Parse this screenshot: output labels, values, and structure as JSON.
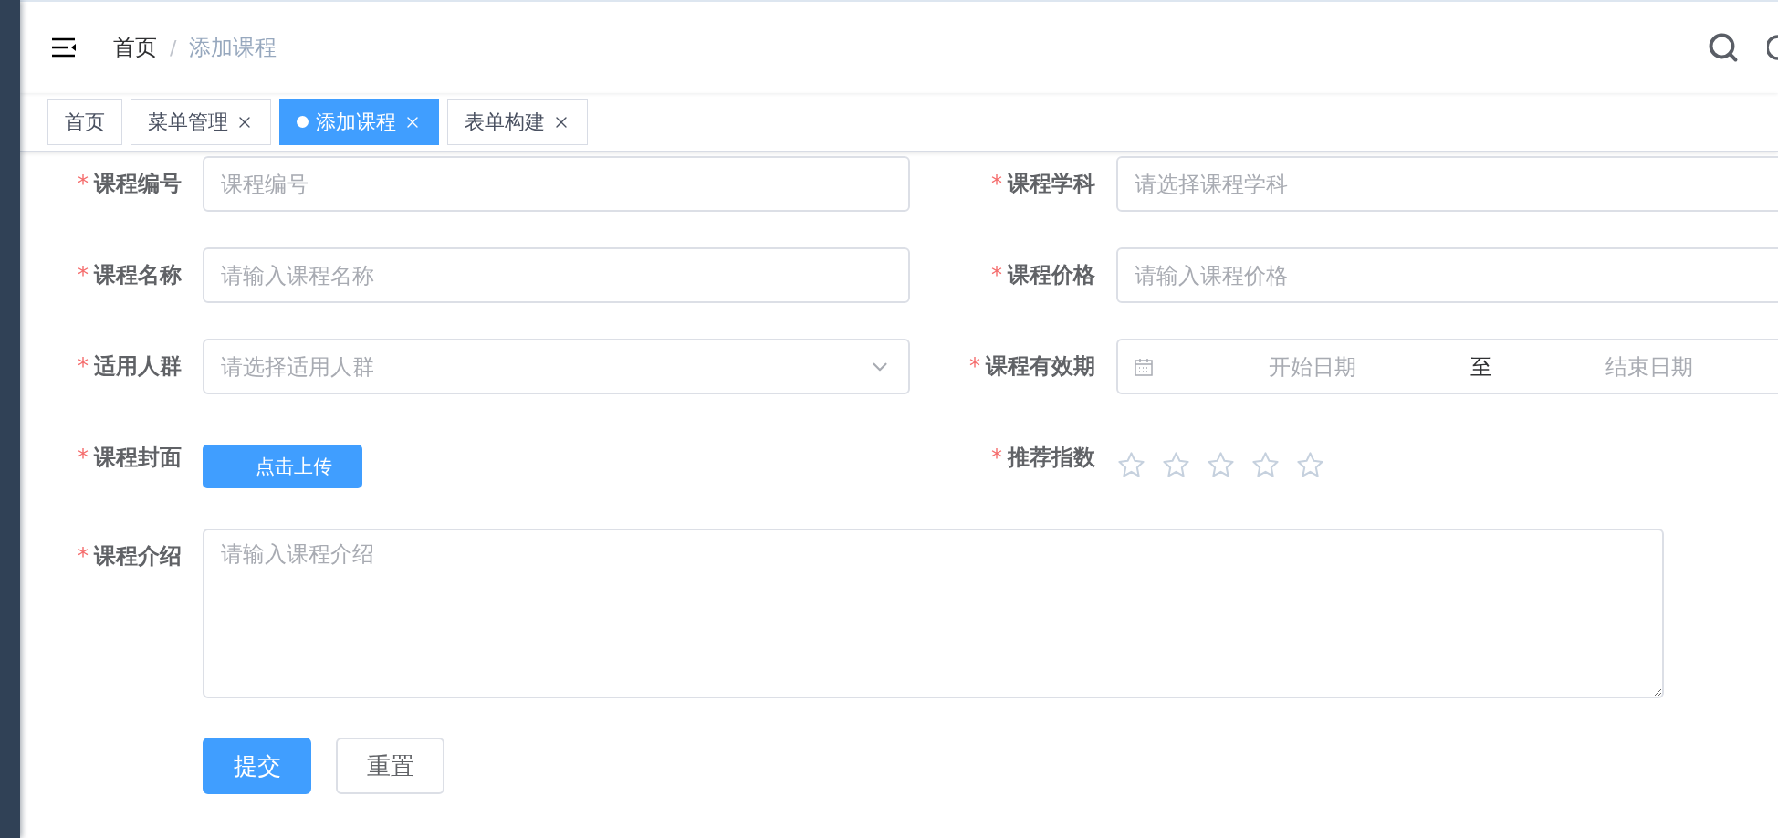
{
  "header": {
    "breadcrumb": [
      {
        "label": "首页",
        "current": false
      },
      {
        "label": "添加课程",
        "current": true
      }
    ],
    "separator": "/"
  },
  "tags": [
    {
      "label": "首页",
      "selected": false,
      "closable": false
    },
    {
      "label": "菜单管理",
      "selected": false,
      "closable": true
    },
    {
      "label": "添加课程",
      "selected": true,
      "closable": true
    },
    {
      "label": "表单构建",
      "selected": false,
      "closable": true
    }
  ],
  "form": {
    "required_mark": "*",
    "rows": [
      [
        {
          "kind": "input",
          "label": "课程编号",
          "required": true,
          "placeholder": "课程编号"
        },
        {
          "kind": "input",
          "label": "课程学科",
          "required": true,
          "placeholder": "请选择课程学科"
        }
      ],
      [
        {
          "kind": "input",
          "label": "课程名称",
          "required": true,
          "placeholder": "请输入课程名称"
        },
        {
          "kind": "input",
          "label": "课程价格",
          "required": true,
          "placeholder": "请输入课程价格"
        }
      ],
      [
        {
          "kind": "select",
          "label": "适用人群",
          "required": true,
          "placeholder": "请选择适用人群"
        },
        {
          "kind": "daterange",
          "label": "课程有效期",
          "required": true,
          "start_placeholder": "开始日期",
          "separator": "至",
          "end_placeholder": "结束日期"
        }
      ],
      [
        {
          "kind": "upload",
          "label": "课程封面",
          "required": true,
          "button": "点击上传"
        },
        {
          "kind": "rate",
          "label": "推荐指数",
          "required": true,
          "stars": 0
        }
      ],
      [
        {
          "kind": "textarea",
          "label": "课程介绍",
          "required": true,
          "placeholder": "请输入课程介绍"
        }
      ]
    ],
    "buttons": [
      {
        "label": "提交",
        "kind": "primary"
      },
      {
        "label": "重置",
        "kind": "default"
      }
    ]
  }
}
